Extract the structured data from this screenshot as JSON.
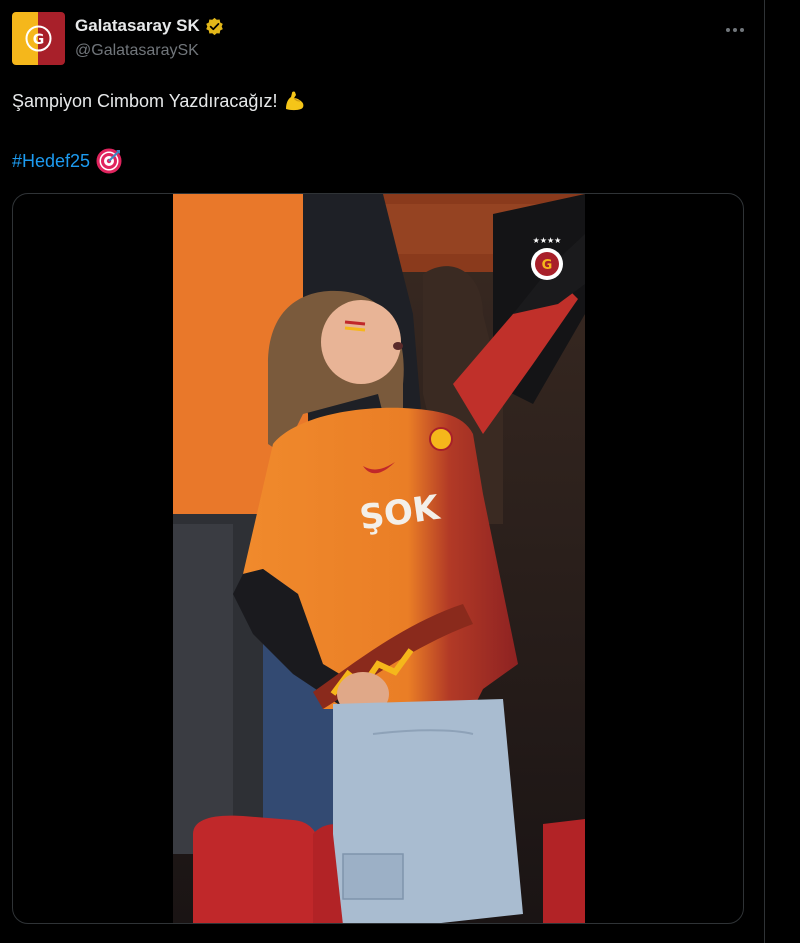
{
  "account": {
    "display_name": "Galatasaray SK",
    "handle": "@GalatasaraySK",
    "verified": true,
    "verified_badge_color": "#e2b719"
  },
  "tweet": {
    "text": "Şampiyon Cimbom Yazdıracağız!",
    "emoji_after_text": "flexed-biceps-emoji",
    "hashtag": "#Hedef25",
    "emoji_after_hashtag": "direct-hit-target-emoji"
  },
  "media": {
    "type": "video",
    "description_icons": [
      "galatasaray-crest-watermark"
    ],
    "shirt_sponsor": "ŞOK"
  },
  "colors": {
    "background": "#000000",
    "text": "#e7e9ea",
    "secondary_text": "#71767b",
    "link": "#1d9bf0",
    "border": "#2f3336",
    "club_orange": "#f08a2c",
    "club_red": "#a8202a"
  },
  "icons": {
    "more": "more-horizontal-icon",
    "verified": "verified-badge-icon"
  }
}
